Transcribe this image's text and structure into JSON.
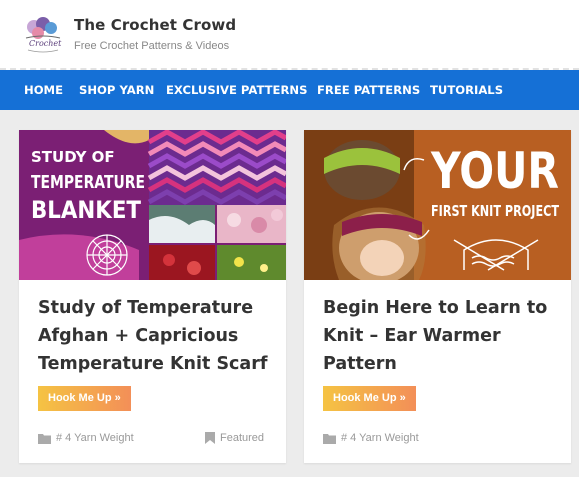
{
  "site": {
    "title": "The Crochet Crowd",
    "tagline": "Free Crochet Patterns & Videos",
    "logo_text": "Crochet"
  },
  "nav": {
    "items": [
      {
        "label": "HOME"
      },
      {
        "label": "SHOP YARN"
      },
      {
        "label": "EXCLUSIVE PATTERNS"
      },
      {
        "label": "FREE PATTERNS"
      },
      {
        "label": "TUTORIALS"
      }
    ]
  },
  "cards": [
    {
      "image_text": [
        "STUDY OF",
        "TEMPERATURE",
        "BLANKET"
      ],
      "title": "Study of Temperature Afghan + Capricious Temperature Knit Scarf",
      "button": "Hook Me Up »",
      "category": "# 4 Yarn Weight",
      "tag": "Featured"
    },
    {
      "image_text": [
        "YOUR",
        "FIRST KNIT PROJECT"
      ],
      "title": "Begin Here to Learn to Knit – Ear Warmer Pattern",
      "button": "Hook Me Up »",
      "category": "# 4 Yarn Weight"
    }
  ],
  "colors": {
    "nav_bg": "#1570d6",
    "button_start": "#f5c343",
    "button_end": "#f38f58",
    "page_bg": "#ececec"
  },
  "icons": [
    "folder-icon",
    "bookmark-icon"
  ]
}
